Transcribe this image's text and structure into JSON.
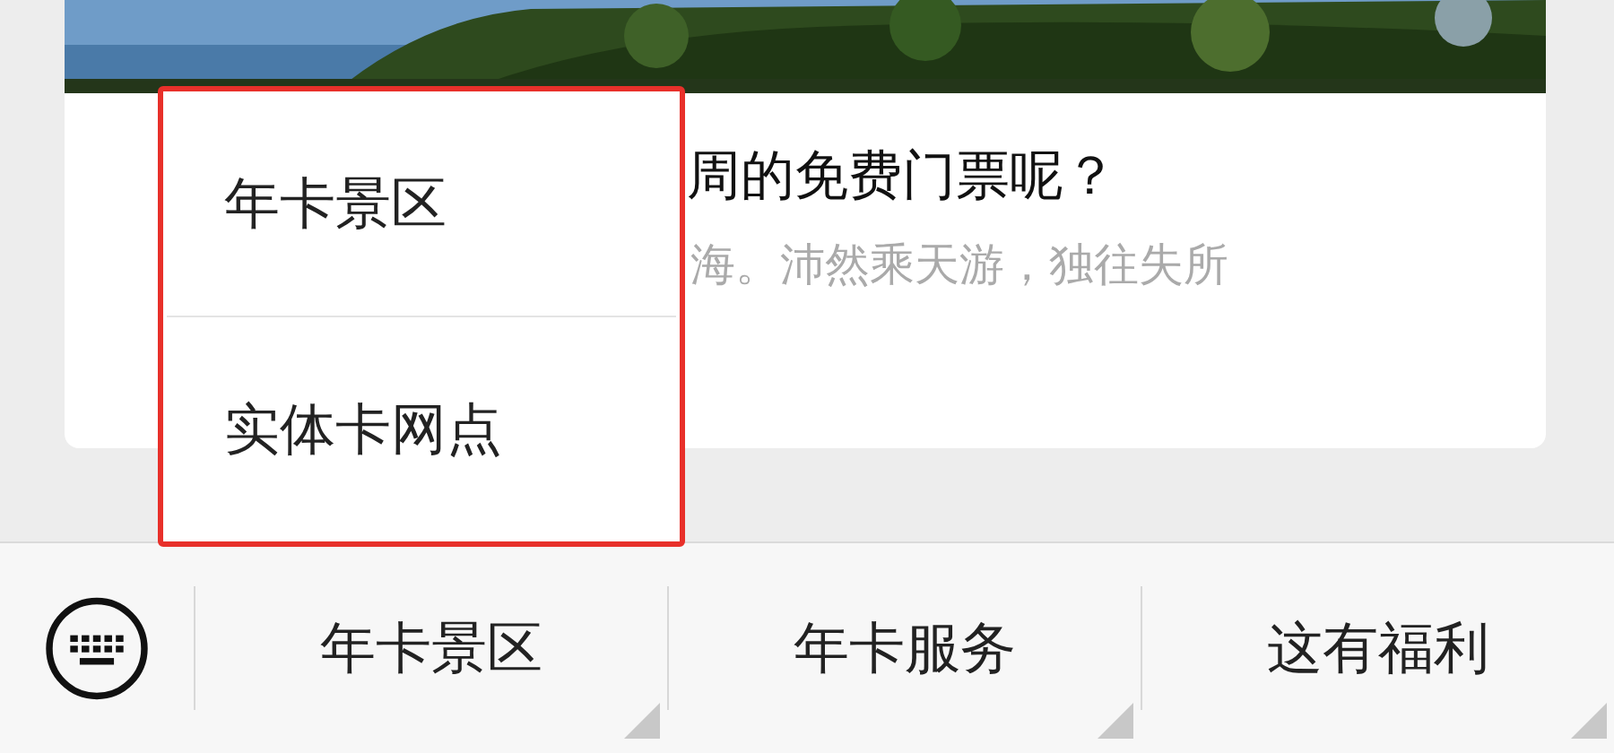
{
  "article": {
    "title": "周的免费门票呢？",
    "summary": "海。沛然乘天游，独往失所"
  },
  "popup_menu": {
    "highlighted": true,
    "items": [
      {
        "label": "年卡景区"
      },
      {
        "label": "实体卡网点"
      }
    ]
  },
  "menu_bar": {
    "items": [
      {
        "label": "年卡景区"
      },
      {
        "label": "年卡服务"
      },
      {
        "label": "这有福利"
      }
    ]
  }
}
